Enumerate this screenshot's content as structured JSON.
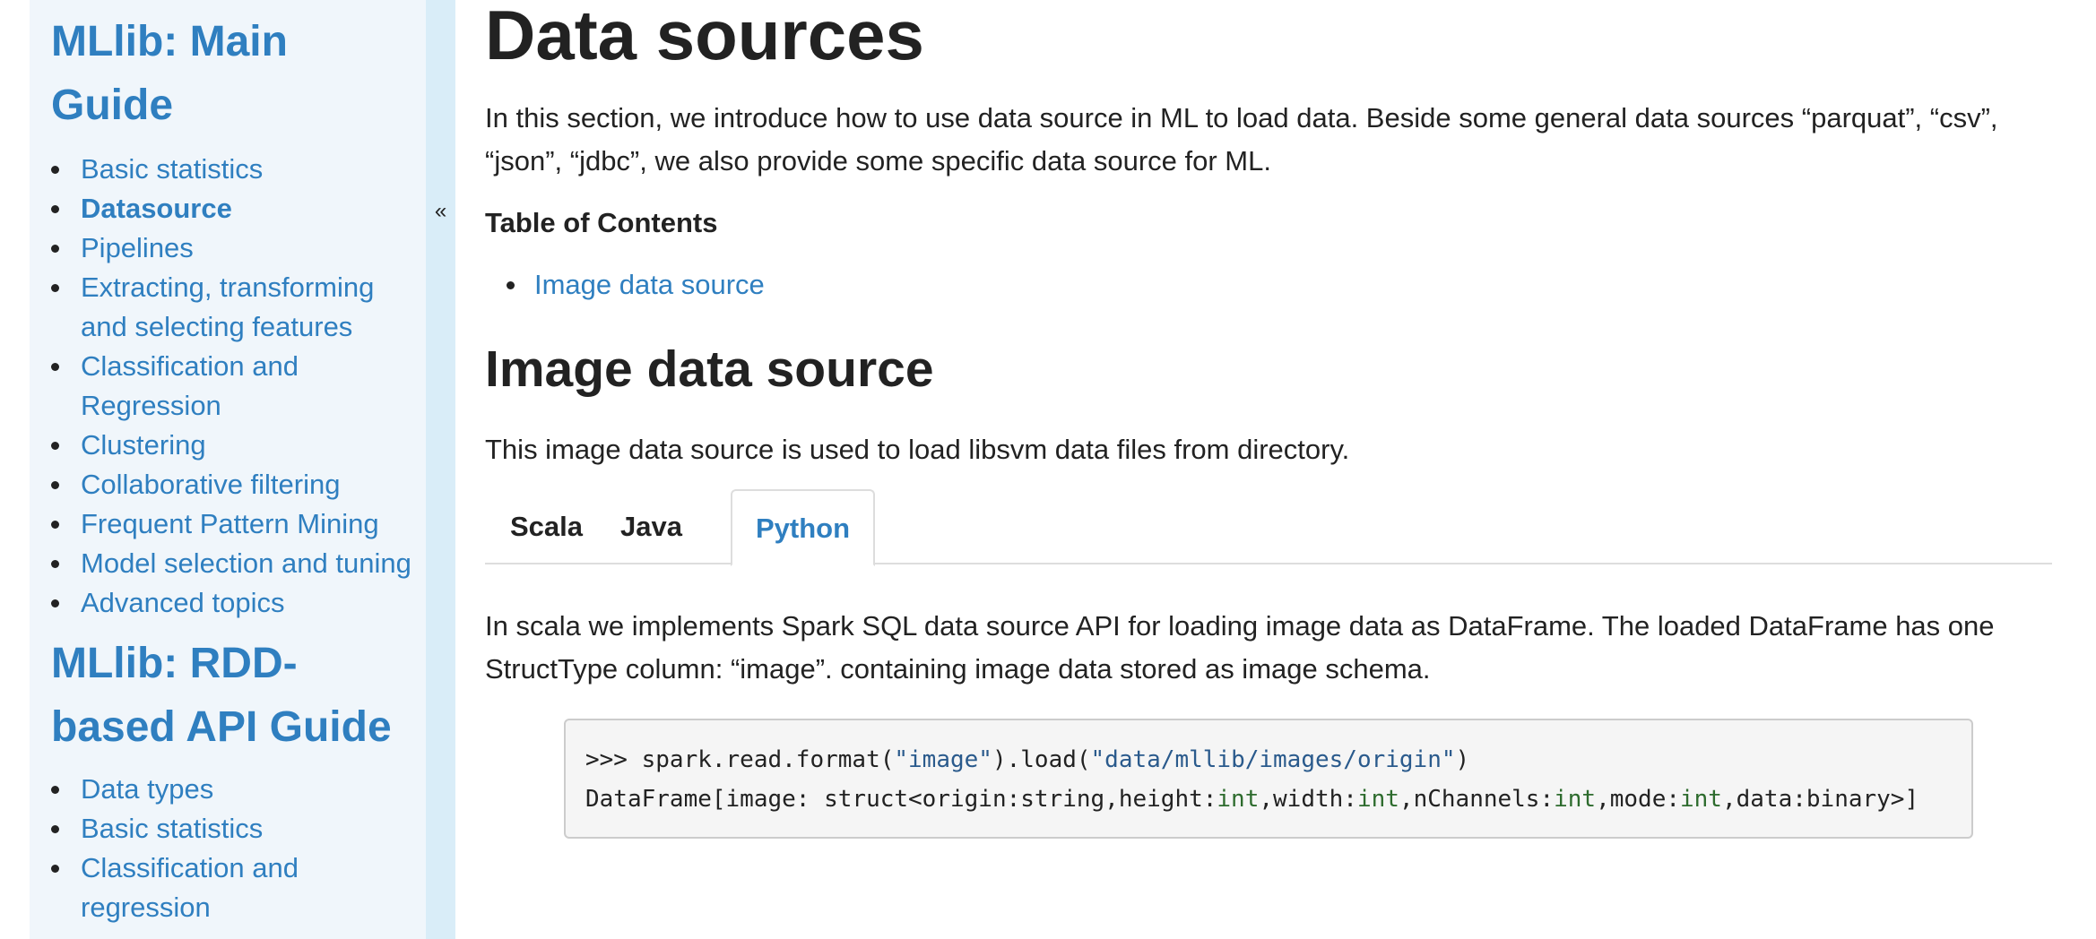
{
  "sidebar": {
    "group1_title": "MLlib: Main Guide",
    "group1_items": [
      {
        "label": "Basic statistics"
      },
      {
        "label": "Datasource"
      },
      {
        "label": "Pipelines"
      },
      {
        "label": "Extracting, transforming and selecting features"
      },
      {
        "label": "Classification and Regression"
      },
      {
        "label": "Clustering"
      },
      {
        "label": "Collaborative filtering"
      },
      {
        "label": "Frequent Pattern Mining"
      },
      {
        "label": "Model selection and tuning"
      },
      {
        "label": "Advanced topics"
      }
    ],
    "group2_title": "MLlib: RDD-based API Guide",
    "group2_items": [
      {
        "label": "Data types"
      },
      {
        "label": "Basic statistics"
      },
      {
        "label": "Classification and regression"
      }
    ],
    "collapse_glyph": "«"
  },
  "main": {
    "title": "Data sources",
    "intro": "In this section, we introduce how to use data source in ML to load data. Beside some general data sources “parquat”, “csv”, “json”, “jdbc”, we also provide some specific data source for ML.",
    "toc_title": "Table of Contents",
    "toc_items": [
      {
        "label": "Image data source"
      }
    ],
    "section_title": "Image data source",
    "section_desc": "This image data source is used to load libsvm data files from directory.",
    "tabs": [
      {
        "label": "Scala"
      },
      {
        "label": "Java"
      },
      {
        "label": "Python"
      }
    ],
    "tab_desc": "In scala we implements Spark SQL data source API for loading image data as DataFrame. The loaded DataFrame has one StructType column: “image”. containing image data stored as image schema.",
    "code": {
      "line1": {
        "a": ">>> spark.read.format(",
        "b": "\"image\"",
        "c": ").load(",
        "d": "\"data/mllib/images/origin\"",
        "e": ")"
      },
      "line2": {
        "a": "DataFrame[image: struct<origin:string,height:",
        "b": "int",
        "c": ",width:",
        "d": "int",
        "e": ",nChannels:",
        "f": "int",
        "g": ",mode:",
        "h": "int",
        "i": ",data:binary>]"
      }
    }
  },
  "colors": {
    "link": "#2f7fc0",
    "sidebar_bg": "#f0f6fb",
    "collapse_bar_bg": "#d9edf8",
    "text": "#222222"
  }
}
